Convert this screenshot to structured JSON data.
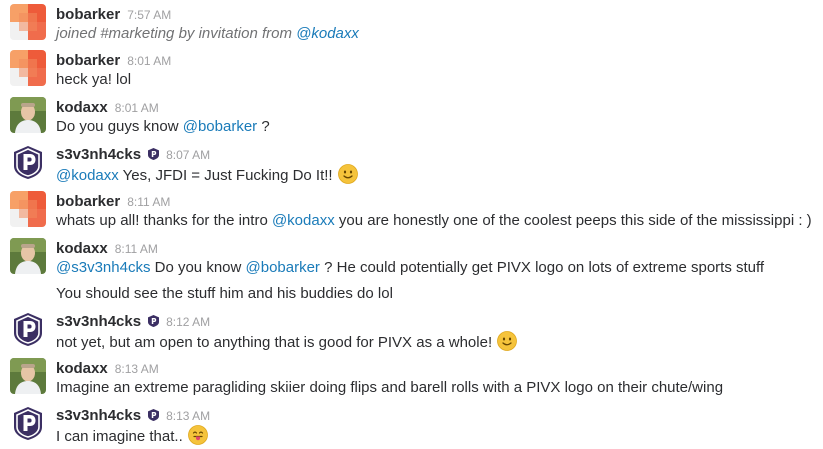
{
  "messages": [
    {
      "user": "bobarker",
      "avatar": "bobarker-avatar",
      "time": "7:57 AM",
      "lines": [
        {
          "system": true,
          "parts": [
            {
              "type": "text",
              "text": "joined #marketing by invitation from "
            },
            {
              "type": "mention",
              "text": "@kodaxx"
            }
          ]
        }
      ]
    },
    {
      "user": "bobarker",
      "avatar": "bobarker-avatar",
      "time": "8:01 AM",
      "lines": [
        {
          "parts": [
            {
              "type": "text",
              "text": "heck ya! lol"
            }
          ]
        }
      ]
    },
    {
      "user": "kodaxx",
      "avatar": "kodaxx-avatar",
      "time": "8:01 AM",
      "lines": [
        {
          "parts": [
            {
              "type": "text",
              "text": "Do you guys know "
            },
            {
              "type": "mention",
              "text": "@bobarker"
            },
            {
              "type": "text",
              "text": " ?"
            }
          ]
        }
      ]
    },
    {
      "user": "s3v3nh4cks",
      "avatar": "pivx-avatar",
      "badge": "pivx-badge-icon",
      "time": "8:07 AM",
      "lines": [
        {
          "parts": [
            {
              "type": "mention",
              "text": "@kodaxx"
            },
            {
              "type": "text",
              "text": " Yes, JFDI = Just Fucking Do It!!"
            },
            {
              "type": "emoji",
              "name": "slightly-smiling-face-emoji"
            }
          ]
        }
      ]
    },
    {
      "user": "bobarker",
      "avatar": "bobarker-avatar",
      "time": "8:11 AM",
      "lines": [
        {
          "parts": [
            {
              "type": "text",
              "text": "whats up all! thanks for the intro "
            },
            {
              "type": "mention",
              "text": "@kodaxx"
            },
            {
              "type": "text",
              "text": " you are honestly one of the coolest peeps this side of the mississippi : )"
            }
          ]
        }
      ]
    },
    {
      "user": "kodaxx",
      "avatar": "kodaxx-avatar",
      "time": "8:11 AM",
      "lines": [
        {
          "parts": [
            {
              "type": "mention",
              "text": "@s3v3nh4cks"
            },
            {
              "type": "text",
              "text": " Do you know "
            },
            {
              "type": "mention",
              "text": "@bobarker"
            },
            {
              "type": "text",
              "text": " ? He could potentially get PIVX logo on lots of extreme sports stuff"
            }
          ]
        },
        {
          "parts": [
            {
              "type": "text",
              "text": "You should see the stuff him and his buddies do lol"
            }
          ]
        }
      ]
    },
    {
      "user": "s3v3nh4cks",
      "avatar": "pivx-avatar",
      "badge": "pivx-badge-icon",
      "time": "8:12 AM",
      "lines": [
        {
          "parts": [
            {
              "type": "text",
              "text": "not yet, but am open to anything that is good for PIVX as a whole!"
            },
            {
              "type": "emoji",
              "name": "slightly-smiling-face-emoji"
            }
          ]
        }
      ]
    },
    {
      "user": "kodaxx",
      "avatar": "kodaxx-avatar",
      "time": "8:13 AM",
      "lines": [
        {
          "parts": [
            {
              "type": "text",
              "text": "Imagine an extreme paragliding skiier doing flips and barell rolls with a PIVX logo on their chute/wing"
            }
          ]
        }
      ]
    },
    {
      "user": "s3v3nh4cks",
      "avatar": "pivx-avatar",
      "badge": "pivx-badge-icon",
      "time": "8:13 AM",
      "lines": [
        {
          "parts": [
            {
              "type": "text",
              "text": "I can imagine that.."
            },
            {
              "type": "emoji",
              "name": "tongue-out-face-emoji"
            }
          ]
        }
      ]
    }
  ],
  "colors": {
    "mention": "#1a7bb9",
    "timestamp": "#a0a0a2",
    "system_text": "#717274",
    "pivx_purple": "#3b2f63"
  }
}
